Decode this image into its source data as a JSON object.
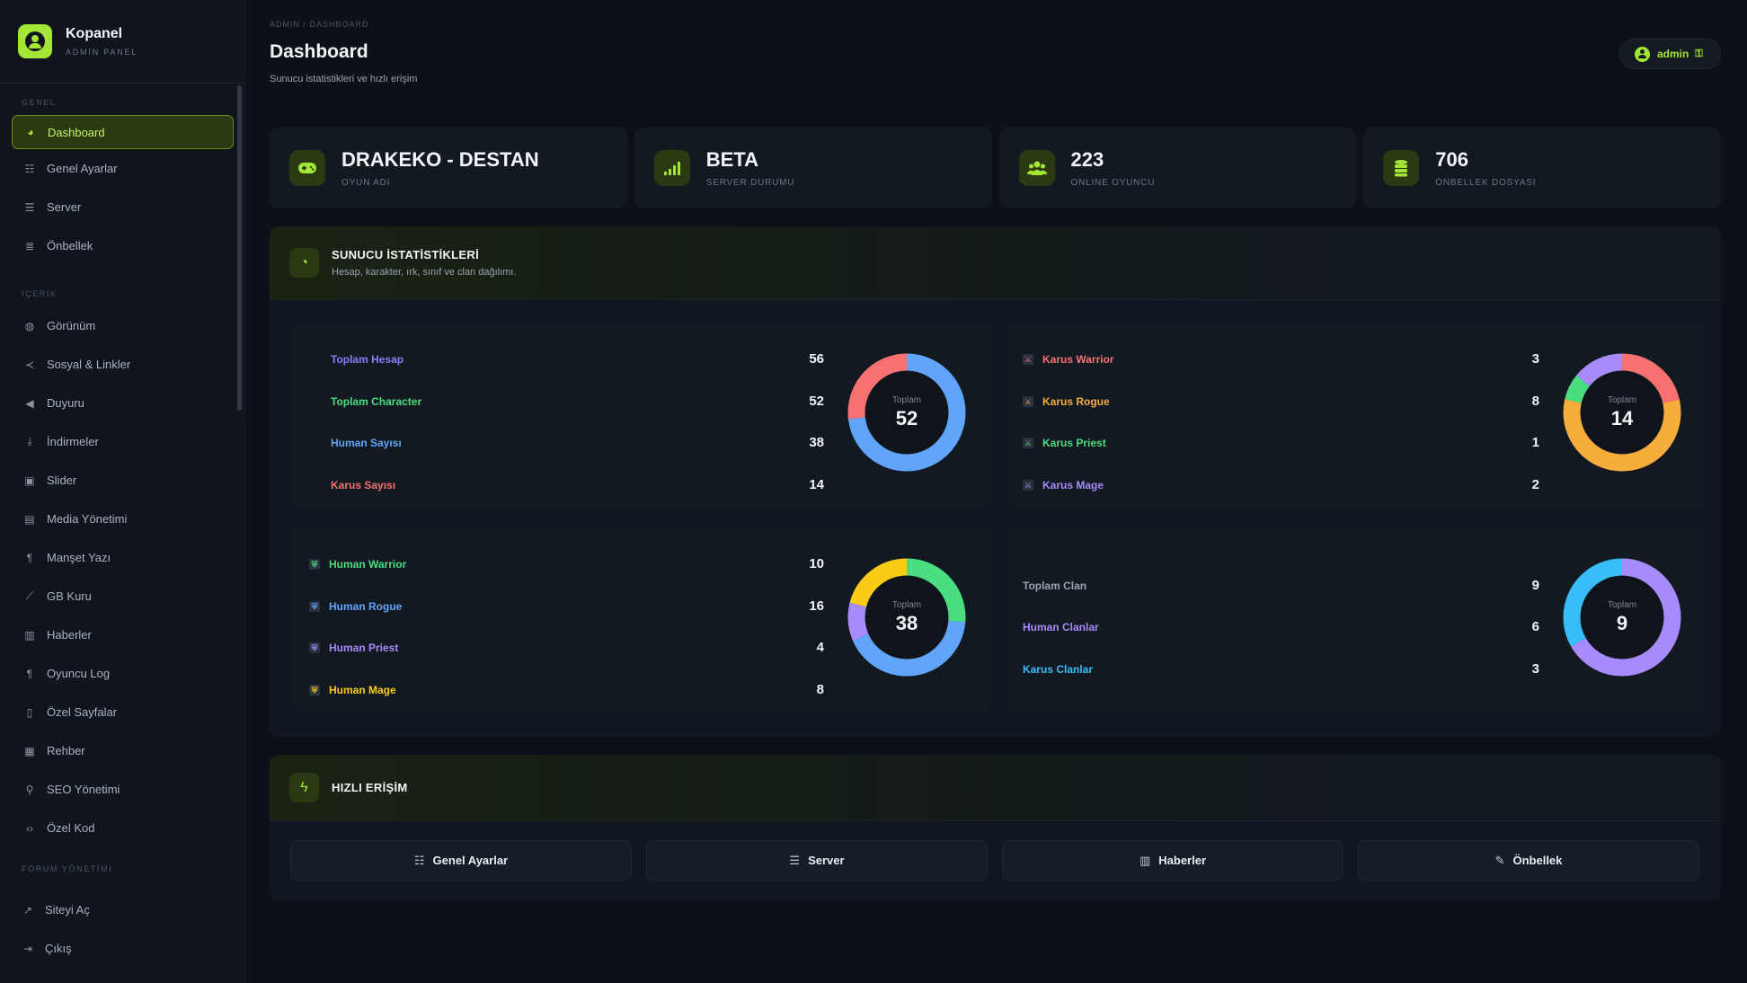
{
  "brand": {
    "name": "Kopanel",
    "subtitle": "ADMIN PANEL"
  },
  "sidebar": {
    "sections": [
      {
        "title": "GENEL",
        "items": [
          {
            "label": "Dashboard",
            "icon": "gauge-icon",
            "active": true
          },
          {
            "label": "Genel Ayarlar",
            "icon": "sliders-icon"
          },
          {
            "label": "Server",
            "icon": "server-icon"
          },
          {
            "label": "Önbellek",
            "icon": "database-icon"
          }
        ]
      },
      {
        "title": "İÇERİK",
        "items": [
          {
            "label": "Görünüm",
            "icon": "palette-icon"
          },
          {
            "label": "Sosyal & Linkler",
            "icon": "share-icon"
          },
          {
            "label": "Duyuru",
            "icon": "megaphone-icon"
          },
          {
            "label": "İndirmeler",
            "icon": "download-icon"
          },
          {
            "label": "Slider",
            "icon": "images-icon"
          },
          {
            "label": "Media Yönetimi",
            "icon": "photo-icon"
          },
          {
            "label": "Manşet Yazı",
            "icon": "heading-icon"
          },
          {
            "label": "GB Kuru",
            "icon": "chart-line-icon"
          },
          {
            "label": "Haberler",
            "icon": "newspaper-icon"
          },
          {
            "label": "Oyuncu Log",
            "icon": "log-icon"
          },
          {
            "label": "Özel Sayfalar",
            "icon": "file-icon"
          },
          {
            "label": "Rehber",
            "icon": "book-icon"
          },
          {
            "label": "SEO Yönetimi",
            "icon": "search-icon"
          },
          {
            "label": "Özel Kod",
            "icon": "code-icon"
          }
        ]
      },
      {
        "title": "FORUM YÖNETİMİ",
        "items": [
          {
            "label": "Siteyi Aç",
            "icon": "external-link-icon"
          },
          {
            "label": "Çıkış",
            "icon": "logout-icon"
          }
        ]
      }
    ]
  },
  "header": {
    "breadcrumb": "ADMIN / DASHBOARD",
    "title": "Dashboard",
    "subtitle": "Sunucu istatistikleri ve hızlı erişim",
    "user": "admin"
  },
  "stats": [
    {
      "value": "DRAKEKO - DESTAN",
      "label": "OYUN ADI",
      "icon": "gamepad-icon"
    },
    {
      "value": "BETA",
      "label": "SERVER DURUMU",
      "icon": "signal-icon"
    },
    {
      "value": "223",
      "label": "ONLINE OYUNCU",
      "icon": "users-icon"
    },
    {
      "value": "706",
      "label": "ÖNBELLEK DOSYASI",
      "icon": "database-icon"
    }
  ],
  "server_panel": {
    "title": "SUNUCU İSTATİSTİKLERİ",
    "subtitle": "Hesap, karakter, ırk, sınıf ve clan dağılımı.",
    "donut_label": "Toplam",
    "blocks": [
      {
        "total": "52",
        "rows": [
          {
            "label": "Toplam Hesap",
            "value": "56",
            "color": "#8b7cf6"
          },
          {
            "label": "Toplam Character",
            "value": "52",
            "color": "#4ade80"
          },
          {
            "label": "Human Sayısı",
            "value": "38",
            "color": "#60a5fa"
          },
          {
            "label": "Karus Sayısı",
            "value": "14",
            "color": "#f87171"
          }
        ]
      },
      {
        "total": "14",
        "rows": [
          {
            "label": "Karus Warrior",
            "value": "3",
            "color": "#f87171",
            "icon": "sword-icon"
          },
          {
            "label": "Karus Rogue",
            "value": "8",
            "color": "#f6ad3c",
            "icon": "sword-icon"
          },
          {
            "label": "Karus Priest",
            "value": "1",
            "color": "#4ade80",
            "icon": "sword-icon"
          },
          {
            "label": "Karus Mage",
            "value": "2",
            "color": "#a78bfa",
            "icon": "sword-icon"
          }
        ]
      },
      {
        "total": "38",
        "rows": [
          {
            "label": "Human Warrior",
            "value": "10",
            "color": "#4ade80",
            "icon": "shield-icon"
          },
          {
            "label": "Human Rogue",
            "value": "16",
            "color": "#60a5fa",
            "icon": "shield-icon"
          },
          {
            "label": "Human Priest",
            "value": "4",
            "color": "#a78bfa",
            "icon": "shield-icon"
          },
          {
            "label": "Human Mage",
            "value": "8",
            "color": "#facc15",
            "icon": "shield-icon"
          }
        ]
      },
      {
        "total": "9",
        "rows": [
          {
            "label": "Toplam Clan",
            "value": "9",
            "color": "#9aa4b1"
          },
          {
            "label": "Human Clanlar",
            "value": "6",
            "color": "#a78bfa"
          },
          {
            "label": "Karus Clanlar",
            "value": "3",
            "color": "#38bdf8"
          }
        ]
      }
    ]
  },
  "quick_access": {
    "title": "HIZLI ERİŞİM",
    "buttons": [
      {
        "label": "Genel Ayarlar",
        "icon": "sliders-icon"
      },
      {
        "label": "Server",
        "icon": "server-icon"
      },
      {
        "label": "Haberler",
        "icon": "newspaper-icon"
      },
      {
        "label": "Önbellek",
        "icon": "broom-icon"
      }
    ]
  },
  "colors": {
    "accent": "#a3e635",
    "background": "#0d1117",
    "card": "#131921"
  },
  "chart_data": [
    {
      "type": "pie",
      "title": "Toplam",
      "total": 52,
      "categories": [
        "Human",
        "Karus"
      ],
      "values": [
        38,
        14
      ],
      "colors": [
        "#60a5fa",
        "#f87171"
      ]
    },
    {
      "type": "pie",
      "title": "Toplam",
      "total": 14,
      "categories": [
        "Karus Warrior",
        "Karus Rogue",
        "Karus Priest",
        "Karus Mage"
      ],
      "values": [
        3,
        8,
        1,
        2
      ],
      "colors": [
        "#f87171",
        "#f6ad3c",
        "#4ade80",
        "#a78bfa"
      ]
    },
    {
      "type": "pie",
      "title": "Toplam",
      "total": 38,
      "categories": [
        "Human Warrior",
        "Human Rogue",
        "Human Priest",
        "Human Mage"
      ],
      "values": [
        10,
        16,
        4,
        8
      ],
      "colors": [
        "#4ade80",
        "#60a5fa",
        "#a78bfa",
        "#facc15"
      ]
    },
    {
      "type": "pie",
      "title": "Toplam",
      "total": 9,
      "categories": [
        "Human Clanlar",
        "Karus Clanlar"
      ],
      "values": [
        6,
        3
      ],
      "colors": [
        "#a78bfa",
        "#38bdf8"
      ]
    }
  ]
}
